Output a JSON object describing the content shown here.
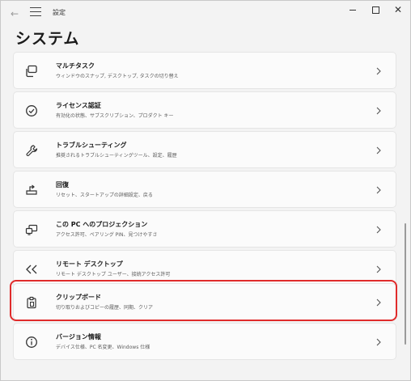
{
  "window": {
    "title": "設定",
    "back_icon": "back-arrow-icon",
    "menu_icon": "hamburger-menu-icon"
  },
  "page": {
    "title": "システム"
  },
  "items": [
    {
      "icon": "multitasking-icon",
      "title": "マルチタスク",
      "desc": "ウィンドウのスナップ, デスクトップ, タスクの切り替え"
    },
    {
      "icon": "activation-icon",
      "title": "ライセンス認証",
      "desc": "有効化の状態、サブスクリプション、プロダクト キー"
    },
    {
      "icon": "troubleshoot-wrench-icon",
      "title": "トラブルシューティング",
      "desc": "推奨されるトラブルシューティングツール、設定、履歴"
    },
    {
      "icon": "recovery-icon",
      "title": "回復",
      "desc": "リセット、スタートアップの詳細設定、戻る"
    },
    {
      "icon": "projection-icon",
      "title": "この PC へのプロジェクション",
      "desc": "アクセス許可、ペアリング PIN、見つけやすさ"
    },
    {
      "icon": "remote-desktop-icon",
      "title": "リモート デスクトップ",
      "desc": "リモート デスクトップ ユーザー、接続アクセス許可"
    },
    {
      "icon": "clipboard-icon",
      "title": "クリップボード",
      "desc": "切り取りおよびコピーの履歴、同期、クリア"
    },
    {
      "icon": "info-icon",
      "title": "バージョン情報",
      "desc": "デバイス仕様、PC 名変更、Windows 仕様"
    }
  ],
  "highlight_color": "#e02b2b"
}
